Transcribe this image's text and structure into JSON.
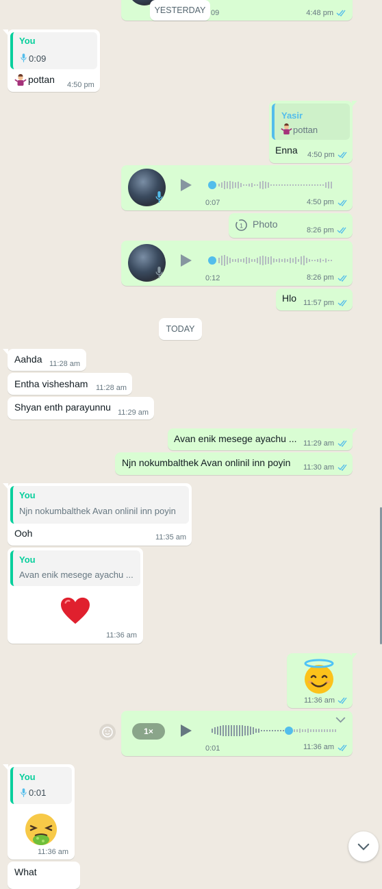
{
  "date_pills": {
    "yesterday": "YESTERDAY",
    "today": "TODAY"
  },
  "top_partial": {
    "duration": "09",
    "time": "4:48 pm"
  },
  "m1": {
    "quote_author": "You",
    "quote_duration": "0:09",
    "text": "pottan",
    "time": "4:50 pm"
  },
  "m2": {
    "quote_author": "Yasir",
    "quote_text": "pottan",
    "text": "Enna",
    "time": "4:50 pm"
  },
  "m3": {
    "duration": "0:07",
    "time": "4:50 pm"
  },
  "m4": {
    "label": "Photo",
    "time": "8:26 pm"
  },
  "m5": {
    "duration": "0:12",
    "time": "8:26 pm"
  },
  "m6": {
    "text": "Hlo",
    "time": "11:57 pm"
  },
  "m7": {
    "text": "Aahda",
    "time": "11:28 am"
  },
  "m8": {
    "text": "Entha vishesham",
    "time": "11:28 am"
  },
  "m9": {
    "text": "Shyan enth parayunnu",
    "time": "11:29 am"
  },
  "m10": {
    "text": "Avan enik mesege ayachu ...",
    "time": "11:29 am"
  },
  "m11": {
    "text": "Njn nokumbalthek Avan onlinil inn  poyin",
    "time": "11:30 am"
  },
  "m12": {
    "quote_author": "You",
    "quote_text": "Njn nokumbalthek Avan onlinil inn  poyin",
    "text": "Ooh",
    "time": "11:35 am"
  },
  "m13": {
    "quote_author": "You",
    "quote_text": "Avan enik mesege ayachu ...",
    "emoji": "red-heart",
    "time": "11:36 am"
  },
  "m14": {
    "emoji": "smiling-face-with-halo",
    "time": "11:36 am"
  },
  "m15": {
    "speed": "1×",
    "duration": "0:01",
    "time": "11:36 am"
  },
  "m16": {
    "quote_author": "You",
    "quote_duration": "0:01",
    "emoji": "nauseated-face",
    "time": "11:36 am"
  },
  "m17": {
    "text": "What"
  },
  "colors": {
    "outgoing": "#d9fdd3",
    "incoming": "#ffffff",
    "read_ticks": "#53bdeb",
    "quote_accent": "#06cf9c",
    "background": "#efeae2"
  }
}
